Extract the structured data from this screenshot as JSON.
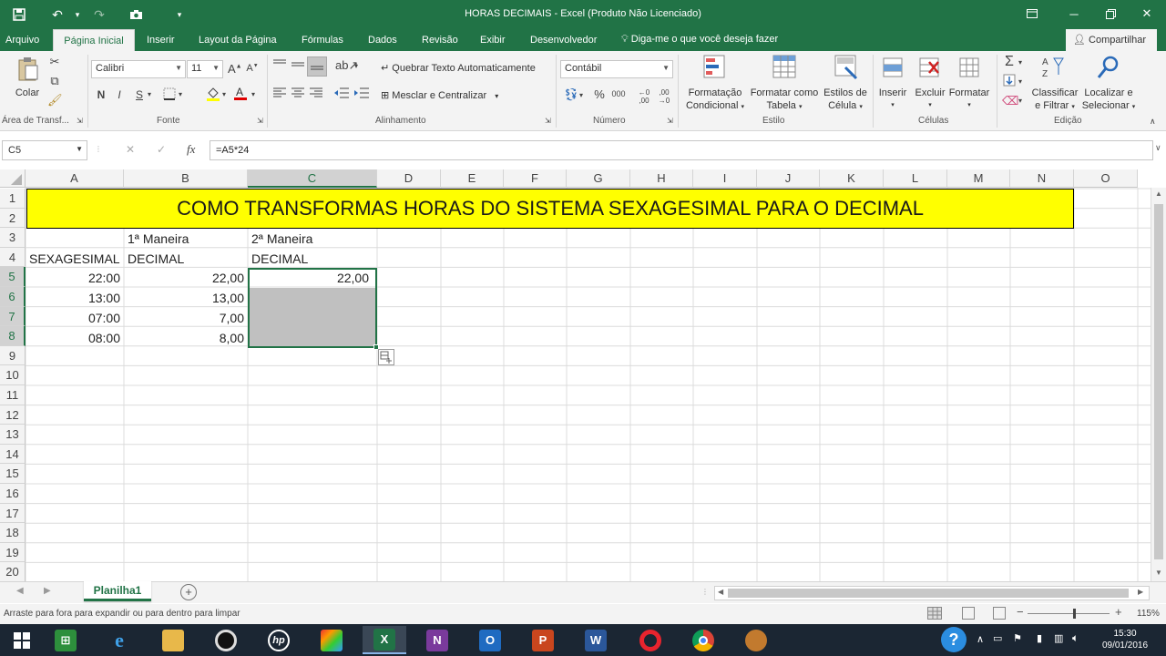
{
  "window": {
    "title": "HORAS DECIMAIS - Excel (Produto Não Licenciado)"
  },
  "quick_access": {
    "save_icon": "save-icon",
    "undo_icon": "undo-icon",
    "redo_icon": "redo-icon",
    "camera_icon": "camera-icon"
  },
  "tabs": [
    {
      "label": "Arquivo"
    },
    {
      "label": "Página Inicial"
    },
    {
      "label": "Inserir"
    },
    {
      "label": "Layout da Página"
    },
    {
      "label": "Fórmulas"
    },
    {
      "label": "Dados"
    },
    {
      "label": "Revisão"
    },
    {
      "label": "Exibir"
    },
    {
      "label": "Desenvolvedor"
    }
  ],
  "tell_me": "Diga-me o que você deseja fazer",
  "share": "Compartilhar",
  "ribbon": {
    "clipboard": {
      "paste": "Colar",
      "group": "Área de Transf..."
    },
    "font": {
      "family": "Calibri",
      "size": "11",
      "bold": "N",
      "italic": "I",
      "underline": "S",
      "group": "Fonte"
    },
    "alignment": {
      "wrap": "Quebrar Texto Automaticamente",
      "merge": "Mesclar e Centralizar",
      "group": "Alinhamento"
    },
    "number": {
      "format": "Contábil",
      "group": "Número"
    },
    "styles": {
      "conditional_1": "Formatação",
      "conditional_2": "Condicional",
      "table_1": "Formatar como",
      "table_2": "Tabela",
      "cell_1": "Estilos de",
      "cell_2": "Célula",
      "group": "Estilo"
    },
    "cells": {
      "insert": "Inserir",
      "delete": "Excluir",
      "format": "Formatar",
      "group": "Células"
    },
    "editing": {
      "sort_1": "Classificar",
      "sort_2": "e Filtrar",
      "find_1": "Localizar e",
      "find_2": "Selecionar",
      "group": "Edição"
    }
  },
  "formula_bar": {
    "name_box": "C5",
    "cancel": "✕",
    "enter": "✓",
    "fx": "fx",
    "formula": "=A5*24"
  },
  "sheet": {
    "columns": [
      "A",
      "B",
      "C",
      "D",
      "E",
      "F",
      "G",
      "H",
      "I",
      "J",
      "K",
      "L",
      "M",
      "N",
      "O"
    ],
    "rows": [
      "1",
      "2",
      "3",
      "4",
      "5",
      "6",
      "7",
      "8",
      "9",
      "10",
      "11",
      "12",
      "13",
      "14",
      "15",
      "16",
      "17",
      "18",
      "19",
      "20"
    ],
    "title": "COMO TRANSFORMAS HORAS DO SISTEMA SEXAGESIMAL PARA O  DECIMAL",
    "b3": "1ª Maneira",
    "c3": "2ª Maneira",
    "a4": "SEXAGESIMAL",
    "b4": "DECIMAL",
    "c4": "DECIMAL",
    "data": [
      {
        "a": "22:00",
        "b": "22,00",
        "c": "22,00"
      },
      {
        "a": "13:00",
        "b": "13,00",
        "c": ""
      },
      {
        "a": "07:00",
        "b": "7,00",
        "c": ""
      },
      {
        "a": "08:00",
        "b": "8,00",
        "c": ""
      }
    ],
    "title_fill": "#ffff00",
    "selection_fill": "#c0c0c0",
    "accent": "#217346"
  },
  "sheet_tabs": {
    "active": "Planilha1"
  },
  "status": {
    "message": "Arraste para fora para expandir ou para dentro para limpar",
    "zoom": "115%"
  },
  "taskbar": {
    "time": "15:30",
    "date": "09/01/2016"
  }
}
